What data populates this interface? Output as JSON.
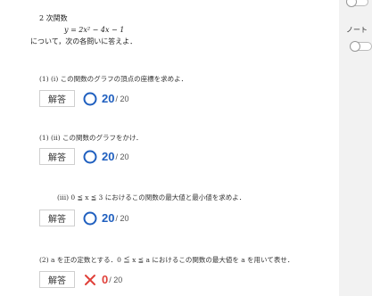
{
  "problem": {
    "heading": "2 次関数",
    "equation": "y = 2x² − 4x − 1",
    "instruction": "について，次の各問いに答えよ．"
  },
  "questions": [
    {
      "text": "(1) (i)  この関数のグラフの頂点の座標を求めよ．",
      "answer_label": "解答",
      "score": "20",
      "max": "/ 20",
      "result": "correct"
    },
    {
      "text": "(1) (ii)  この関数のグラフをかけ．",
      "answer_label": "解答",
      "score": "20",
      "max": "/ 20",
      "result": "correct"
    },
    {
      "text": "(iii)  0 ≦ x ≦ 3 におけるこの関数の最大値と最小値を求めよ．",
      "answer_label": "解答",
      "score": "20",
      "max": "/ 20",
      "result": "correct"
    },
    {
      "text": "(2)  a を正の定数とする．0 ≦ x ≦ a におけるこの関数の最大値を a を用いて表せ．",
      "answer_label": "解答",
      "score": "0",
      "max": "/ 20",
      "result": "incorrect"
    }
  ],
  "sidebar": {
    "note_label": "ノート"
  },
  "colors": {
    "correct": "#1f5fbf",
    "incorrect": "#e0413a"
  }
}
